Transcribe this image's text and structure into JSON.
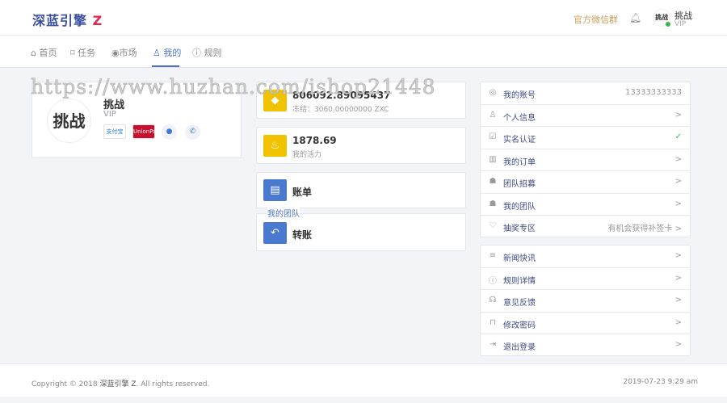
{
  "header": {
    "logo": "深蓝引擎",
    "logo_mark": "Z",
    "wechat_group": "官方微信群",
    "user_name": "挑战",
    "user_level": "VIP",
    "avatar_text": "挑战"
  },
  "nav": [
    {
      "label": "首页",
      "icon": "home-icon"
    },
    {
      "label": "任务",
      "icon": "bookmark-icon"
    },
    {
      "label": "市场",
      "icon": "eye-icon"
    },
    {
      "label": "我的",
      "icon": "user-icon",
      "active": true
    },
    {
      "label": "规则",
      "icon": "help-icon"
    }
  ],
  "profile": {
    "name": "挑战",
    "level": "VIP",
    "avatar_text": "挑战",
    "alipay": "支付宝",
    "unionpay": "UnionPay"
  },
  "wallet": {
    "balance": "806092.89095437",
    "frozen": "冻结：3060.00000000 ZXC",
    "vitality": "1878.69",
    "vitality_label": "我的活力",
    "bill": "账单",
    "transfer": "转账",
    "overlay_text": "我的团队"
  },
  "account_list": [
    {
      "label": "我的账号",
      "value": "13333333333",
      "icon": "account-icon"
    },
    {
      "label": "个人信息",
      "value": ">",
      "icon": "user-icon"
    },
    {
      "label": "实名认证",
      "value": "✓",
      "icon": "check-square-icon"
    },
    {
      "label": "我的订单",
      "value": ">",
      "icon": "bar-chart-icon"
    },
    {
      "label": "团队招募",
      "value": ">",
      "icon": "user-plus-icon"
    },
    {
      "label": "我的团队",
      "value": ">",
      "icon": "users-icon"
    },
    {
      "label": "抽奖专区",
      "value": "有机会获得补签卡 >",
      "icon": "heart-icon"
    }
  ],
  "misc_list": [
    {
      "label": "新闻快讯",
      "value": ">",
      "icon": "list-icon"
    },
    {
      "label": "规则详情",
      "value": ">",
      "icon": "help-icon"
    },
    {
      "label": "意见反馈",
      "value": ">",
      "icon": "headphones-icon"
    },
    {
      "label": "修改密码",
      "value": ">",
      "icon": "lock-icon"
    },
    {
      "label": "退出登录",
      "value": ">",
      "icon": "logout-icon"
    }
  ],
  "footer": {
    "copyright": "Copyright © 2018",
    "brand": "深蓝引擎 Z",
    "rights": ". All rights reserved.",
    "datetime": "2019-07-23 9:29 am"
  },
  "watermark": "https://www.huzhan.com/ishop21448"
}
